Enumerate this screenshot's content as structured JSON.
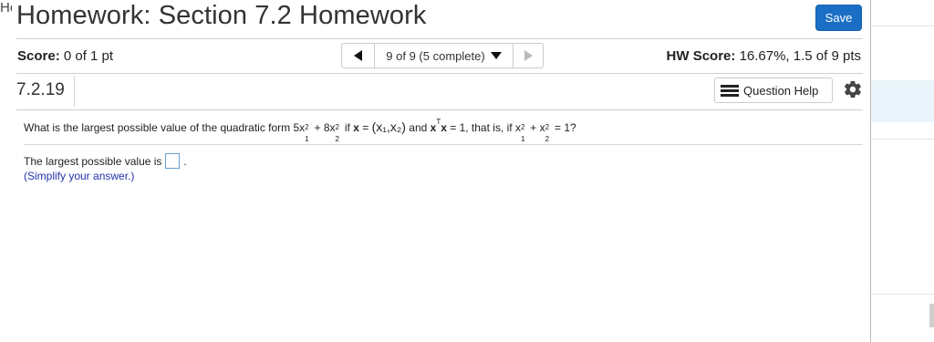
{
  "background": {
    "corner_text": "Ho"
  },
  "header": {
    "title": "Homework: Section 7.2 Homework",
    "save_label": "Save"
  },
  "score": {
    "label": "Score:",
    "value": "0 of 1 pt"
  },
  "navigation": {
    "position_text": "9 of 9 (5 complete)"
  },
  "hw_score": {
    "label": "HW Score:",
    "value": "16.67%, 1.5 of 9 pts"
  },
  "question": {
    "number": "7.2.19",
    "help_label": "Question Help",
    "prompt_parts": {
      "intro": "What is the largest possible value of the quadratic form 5x",
      "sup2": "2",
      "sub1": "1",
      "plus": " + 8x",
      "sub2": "2",
      "if": " if ",
      "bold_x": "x",
      "eq": " = ",
      "vector": "(x₁,x₂)",
      "and": " and ",
      "transpose": "T",
      "eq1": " = 1, that is, if x",
      "plus2": " + x",
      "end": " = 1?"
    },
    "answer_label": "The largest possible value is",
    "answer_value": "",
    "answer_suffix": ".",
    "hint": "(Simplify your answer.)"
  },
  "colors": {
    "save_button": "#1a6fc4",
    "hint_text": "#2233aa",
    "answer_box_border": "#6a9fd0"
  },
  "icons": [
    "left-arrow-icon",
    "dropdown-arrow-icon",
    "right-arrow-icon",
    "list-icon",
    "gear-icon"
  ]
}
